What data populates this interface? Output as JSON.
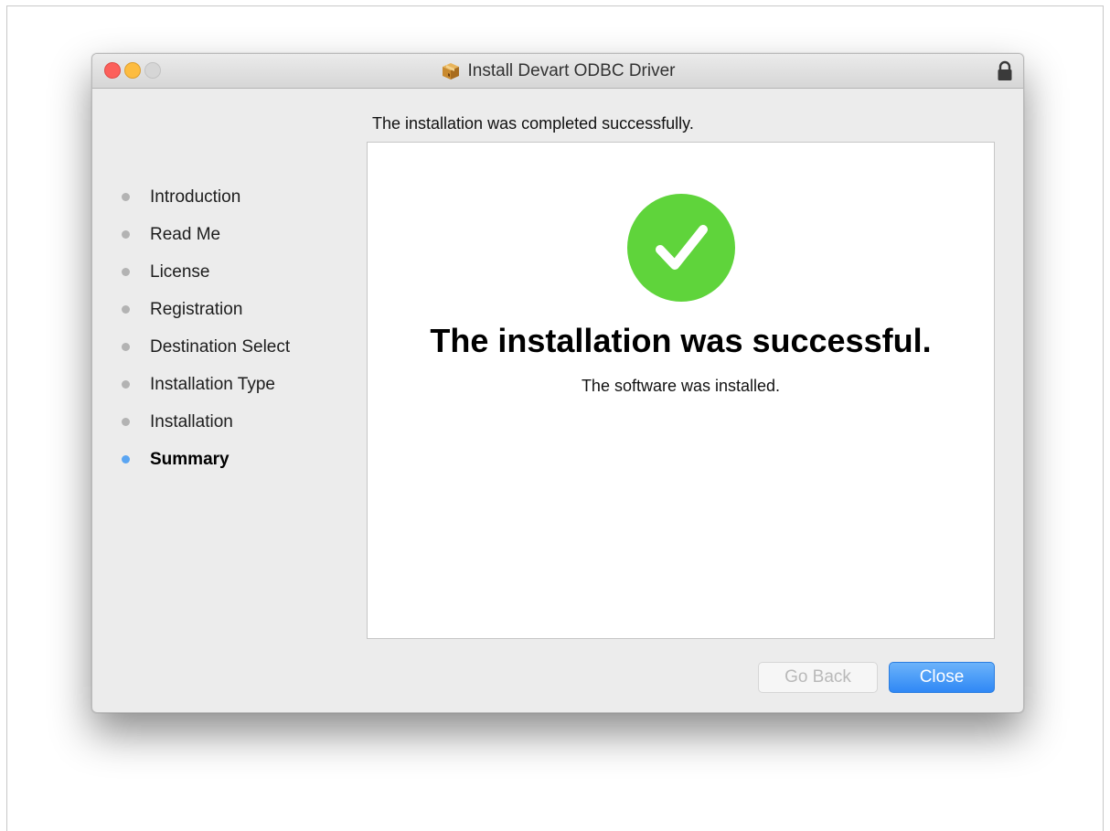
{
  "window": {
    "title": "Install Devart ODBC Driver",
    "icons": {
      "package": "package-icon",
      "lock": "lock-icon"
    }
  },
  "header": {
    "text": "The installation was completed successfully."
  },
  "sidebar": {
    "steps": [
      {
        "label": "Introduction",
        "active": false
      },
      {
        "label": "Read Me",
        "active": false
      },
      {
        "label": "License",
        "active": false
      },
      {
        "label": "Registration",
        "active": false
      },
      {
        "label": "Destination Select",
        "active": false
      },
      {
        "label": "Installation Type",
        "active": false
      },
      {
        "label": "Installation",
        "active": false
      },
      {
        "label": "Summary",
        "active": true
      }
    ]
  },
  "content": {
    "icon": "checkmark-success-icon",
    "title": "The installation was successful.",
    "subtitle": "The software was installed."
  },
  "buttons": {
    "back_label": "Go Back",
    "close_label": "Close"
  },
  "colors": {
    "success_green": "#5fd43b",
    "accent_blue": "#2f88f5",
    "active_dot": "#5aa5f2",
    "close_light": "#fc605b",
    "minimize_light": "#fdbc40"
  }
}
